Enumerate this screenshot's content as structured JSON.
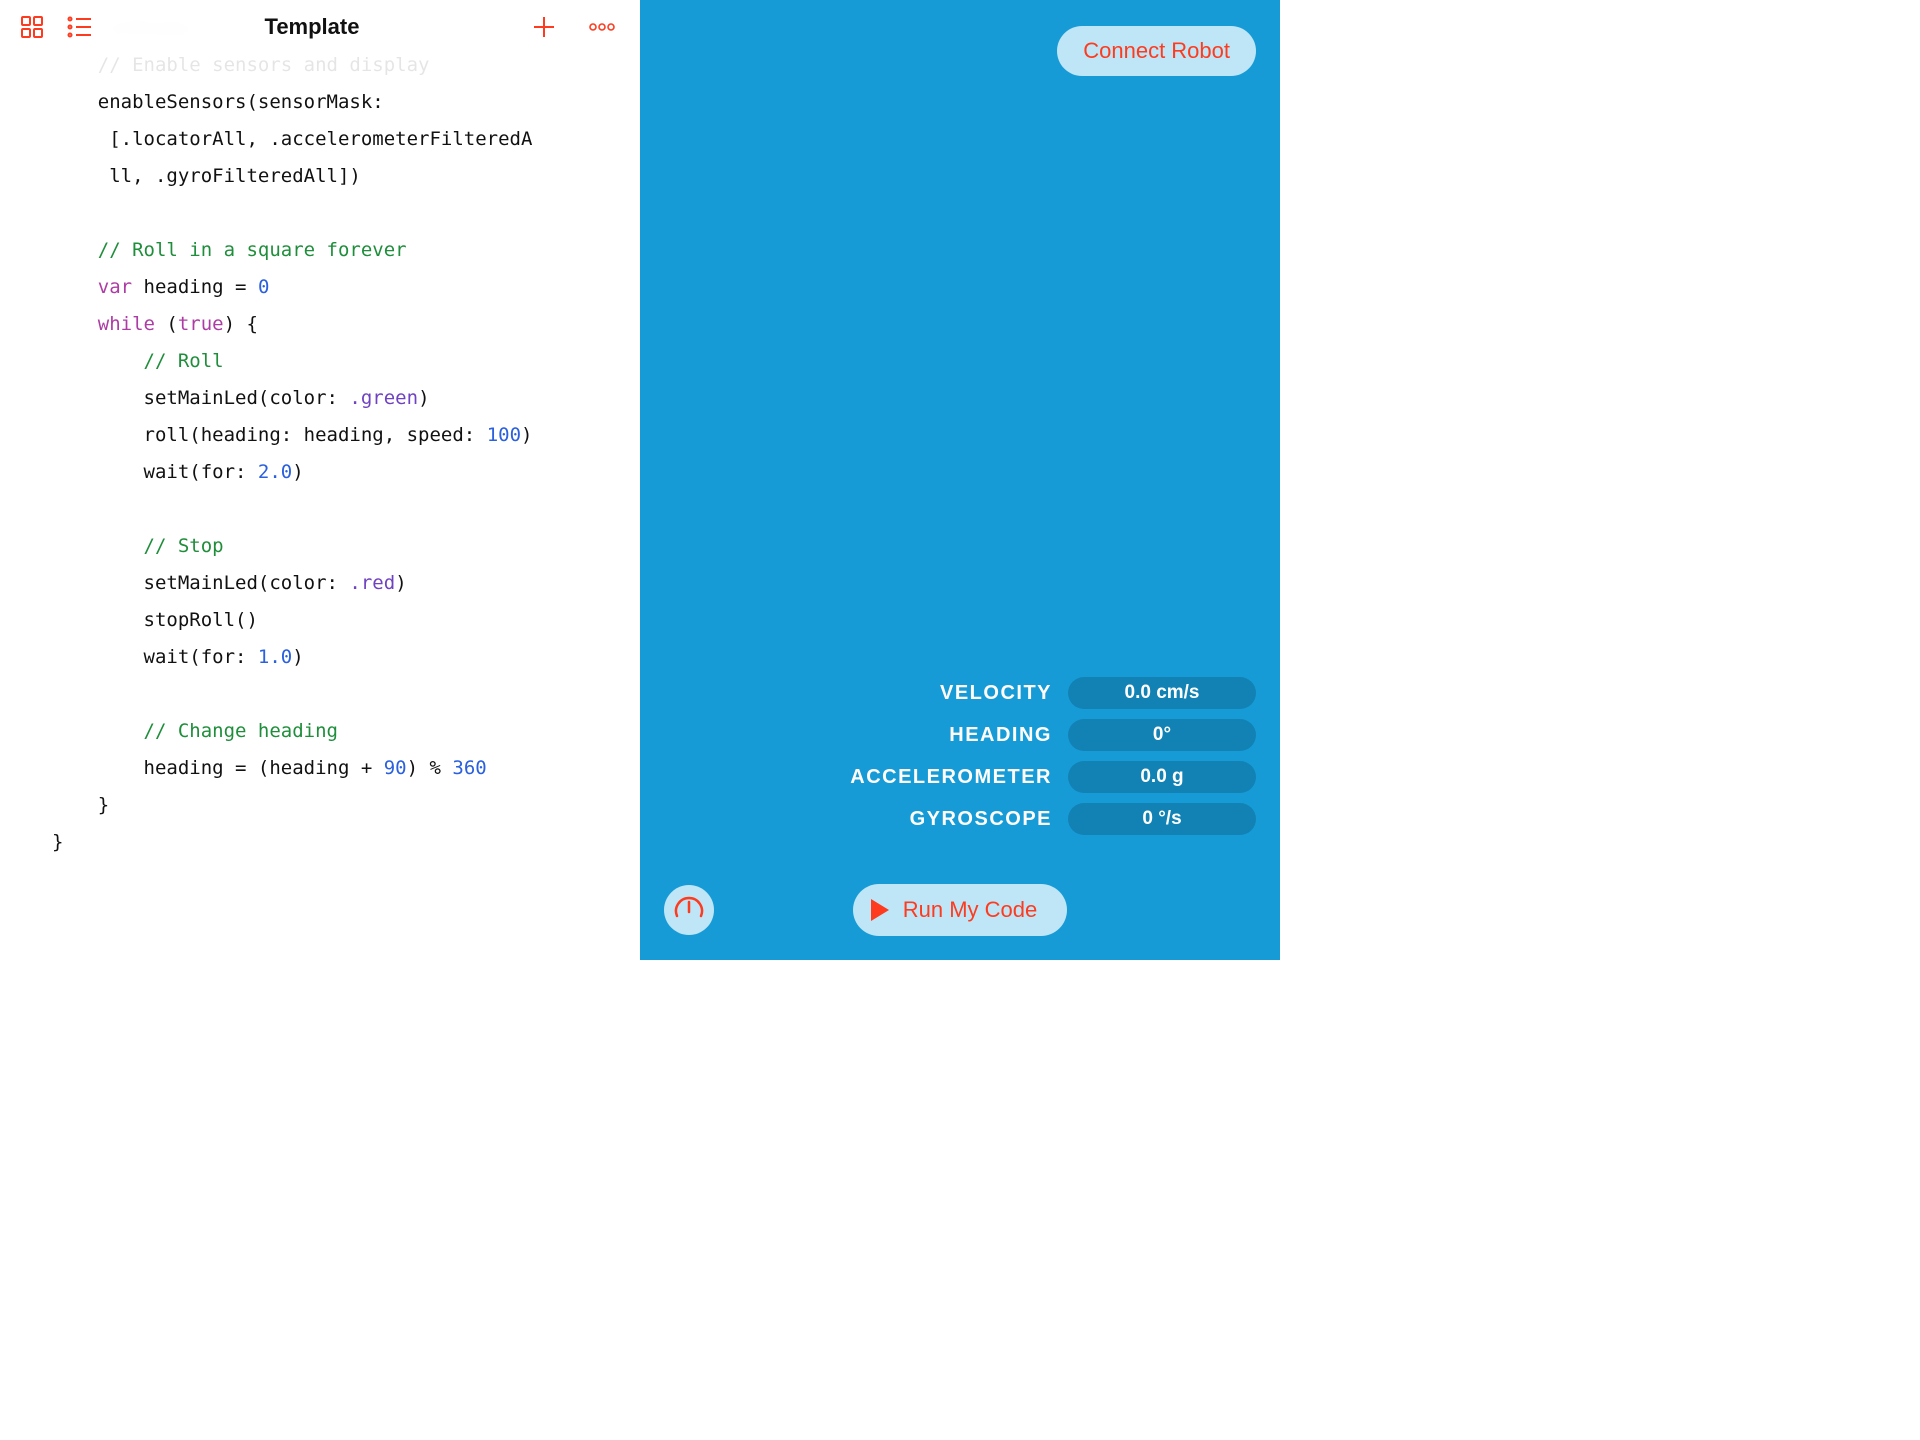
{
  "toolbar": {
    "title": "Template"
  },
  "code": {
    "ghost_lines": [
      "func onReady() {",
      "    // Enable sensors and display"
    ],
    "lines": [
      {
        "indent": 1,
        "type": "plain",
        "text": "enableSensors(sensorMask:"
      },
      {
        "indent": 1,
        "type": "plain",
        "text": " [.locatorAll, .accelerometerFilteredA"
      },
      {
        "indent": 1,
        "type": "plain",
        "text": " ll, .gyroFilteredAll])"
      },
      {
        "indent": 0,
        "type": "blank"
      },
      {
        "indent": 1,
        "type": "comment",
        "text": "// Roll in a square forever"
      },
      {
        "indent": 1,
        "type": "vardecl",
        "kw": "var",
        "rest": " heading = ",
        "num": "0"
      },
      {
        "indent": 1,
        "type": "whiletrue",
        "kw": "while",
        "bool": "true"
      },
      {
        "indent": 2,
        "type": "comment",
        "text": "// Roll"
      },
      {
        "indent": 2,
        "type": "callcolor",
        "call": "setMainLed(color: ",
        "val": ".green",
        "tail": ")"
      },
      {
        "indent": 2,
        "type": "rollcall",
        "pre": "roll(heading: heading, speed: ",
        "num": "100",
        "post": ")"
      },
      {
        "indent": 2,
        "type": "waitcall",
        "pre": "wait(for: ",
        "num": "2.0",
        "post": ")"
      },
      {
        "indent": 0,
        "type": "blank"
      },
      {
        "indent": 2,
        "type": "comment",
        "text": "// Stop"
      },
      {
        "indent": 2,
        "type": "callcolor",
        "call": "setMainLed(color: ",
        "val": ".red",
        "tail": ")"
      },
      {
        "indent": 2,
        "type": "plain",
        "text": "stopRoll()"
      },
      {
        "indent": 2,
        "type": "waitcall",
        "pre": "wait(for: ",
        "num": "1.0",
        "post": ")"
      },
      {
        "indent": 0,
        "type": "blank"
      },
      {
        "indent": 2,
        "type": "comment",
        "text": "// Change heading"
      },
      {
        "indent": 2,
        "type": "modline",
        "pre": "heading = (heading + ",
        "n1": "90",
        "mid": ") % ",
        "n2": "360"
      },
      {
        "indent": 1,
        "type": "plain",
        "text": "}"
      },
      {
        "indent": 0,
        "type": "plain",
        "text": "}"
      }
    ]
  },
  "right": {
    "connect_label": "Connect Robot",
    "run_label": "Run My Code",
    "sensors": [
      {
        "label": "VELOCITY",
        "value": "0.0 cm/s"
      },
      {
        "label": "HEADING",
        "value": "0°"
      },
      {
        "label": "ACCELEROMETER",
        "value": "0.0 g"
      },
      {
        "label": "GYROSCOPE",
        "value": "0 °/s"
      }
    ]
  }
}
